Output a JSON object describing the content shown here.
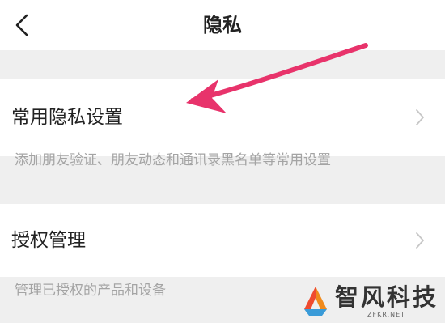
{
  "header": {
    "title": "隐私",
    "back_icon": "chevron-left-icon"
  },
  "settings": [
    {
      "label": "常用隐私设置",
      "description": "添加朋友验证、朋友动态和通讯录黑名单等常用设置",
      "icon": "chevron-right-icon"
    },
    {
      "label": "授权管理",
      "description": "管理已授权的产品和设备",
      "icon": "chevron-right-icon"
    }
  ],
  "annotation": {
    "arrow_color": "#e8336b",
    "points_to": "常用隐私设置"
  },
  "watermark": {
    "name": "智风科技",
    "domain": "ZFKR.NET",
    "logo_icon": "zf-logo-icon"
  },
  "colors": {
    "background": "#ffffff",
    "section_gap": "#efefef",
    "text_primary": "#222222",
    "text_secondary": "#a4a4a4",
    "chevron": "#c7c7c7"
  }
}
